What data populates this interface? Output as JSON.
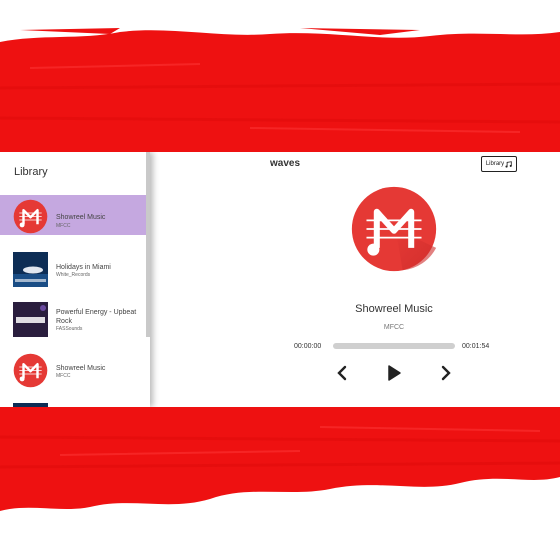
{
  "app": {
    "title": "waves",
    "library_button_label": "Library"
  },
  "library": {
    "title": "Library",
    "tracks": [
      {
        "title": "Showreel Music",
        "artist": "MFCC",
        "art": "mfcc-logo",
        "active": true
      },
      {
        "title": "Holidays in Miami",
        "artist": "White_Records",
        "art": "miami-cover"
      },
      {
        "title": "Powerful Energy - Upbeat Rock",
        "artist": "FASSounds",
        "art": "fass-cover"
      },
      {
        "title": "Showreel Music",
        "artist": "MFCC",
        "art": "mfcc-logo"
      }
    ]
  },
  "player": {
    "title": "Showreel Music",
    "artist": "MFCC",
    "current_time": "00:00:00",
    "duration": "00:01:54",
    "progress": 0
  },
  "colors": {
    "brush_red": "#ee1111",
    "active_row": "#c5a8e0",
    "logo_red": "#e53935"
  },
  "icons": [
    "music-note-icon",
    "previous-icon",
    "play-icon",
    "next-icon"
  ]
}
